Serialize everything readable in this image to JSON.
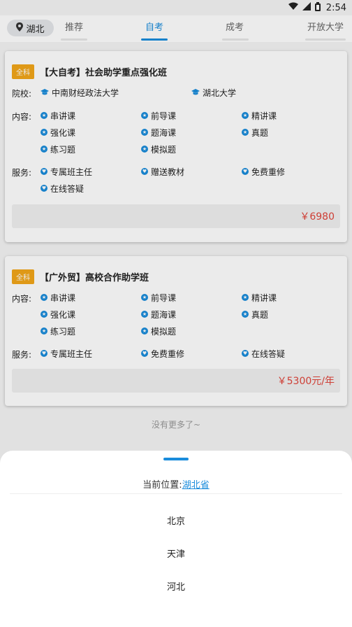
{
  "status": {
    "time": "2:54"
  },
  "header": {
    "city": "湖北",
    "tabs": [
      {
        "label": "推荐",
        "active": false
      },
      {
        "label": "自考",
        "active": true
      },
      {
        "label": "成考",
        "active": false
      },
      {
        "label": "开放大学",
        "active": false
      }
    ]
  },
  "cards": [
    {
      "tag": "全科",
      "title": "【大自考】社会助学重点强化班",
      "school_label": "院校:",
      "schools": [
        "中南财经政法大学",
        "湖北大学"
      ],
      "content_label": "内容:",
      "contents": [
        "串讲课",
        "前导课",
        "精讲课",
        "强化课",
        "题海课",
        "真题",
        "练习题",
        "模拟题"
      ],
      "service_label": "服务:",
      "services": [
        "专属班主任",
        "赠送教材",
        "免费重修",
        "在线答疑"
      ],
      "price": "￥6980"
    },
    {
      "tag": "全科",
      "title": "【广外贸】高校合作助学班",
      "content_label": "内容:",
      "contents": [
        "串讲课",
        "前导课",
        "精讲课",
        "强化课",
        "题海课",
        "真题",
        "练习题",
        "模拟题"
      ],
      "service_label": "服务:",
      "services": [
        "专属班主任",
        "免费重修",
        "在线答疑"
      ],
      "price": "￥5300元/年"
    }
  ],
  "no_more": "没有更多了~",
  "sheet": {
    "current_label": "当前位置:",
    "current_province": "湖北省",
    "cities": [
      "北京",
      "天津",
      "河北"
    ]
  },
  "colors": {
    "accent": "#1a8cdc",
    "price": "#e0453b",
    "tag": "#f2a619"
  }
}
